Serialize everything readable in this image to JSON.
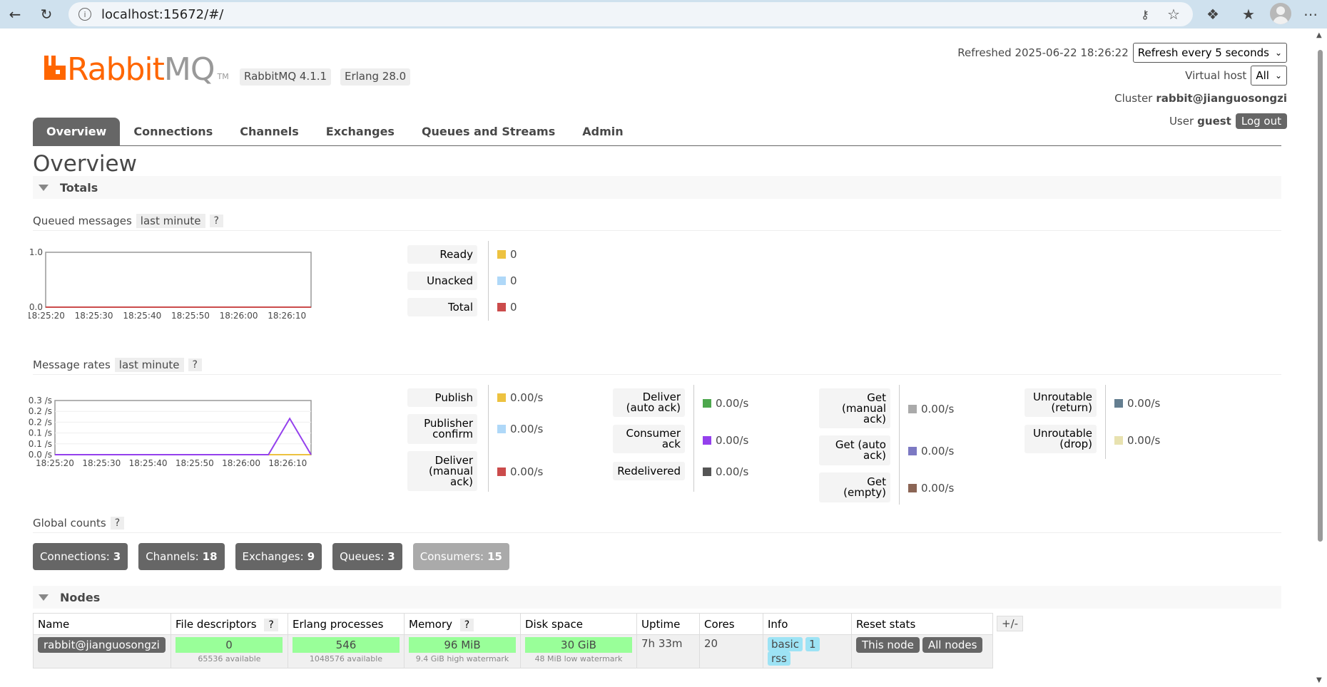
{
  "browser": {
    "url": "localhost:15672/#/"
  },
  "app": {
    "logo_rabbit": "Rabbit",
    "logo_mq": "MQ",
    "logo_tm": "TM",
    "rabbitmq_version": "RabbitMQ 4.1.1",
    "erlang_version": "Erlang 28.0",
    "refreshed_label": "Refreshed",
    "refreshed_time": "2025-06-22 18:26:22",
    "refresh_select": "Refresh every 5 seconds",
    "vhost_label": "Virtual host",
    "vhost_value": "All",
    "cluster_label": "Cluster",
    "cluster_value": "rabbit@jianguosongzi",
    "user_label": "User",
    "user_value": "guest",
    "logout_label": "Log out"
  },
  "tabs": [
    "Overview",
    "Connections",
    "Channels",
    "Exchanges",
    "Queues and Streams",
    "Admin"
  ],
  "page_title": "Overview",
  "totals": {
    "section_label": "Totals",
    "queued_label": "Queued messages",
    "queued_range": "last minute",
    "help": "?",
    "rates_label": "Message rates",
    "rates_range": "last minute",
    "queued_legend": [
      {
        "label": "Ready",
        "value": "0",
        "color": "#edc240"
      },
      {
        "label": "Unacked",
        "value": "0",
        "color": "#afd8f8"
      },
      {
        "label": "Total",
        "value": "0",
        "color": "#cb4b4b"
      }
    ],
    "rates_legend_col1": [
      {
        "label": "Publish",
        "value": "0.00/s",
        "color": "#edc240"
      },
      {
        "label": "Publisher confirm",
        "value": "0.00/s",
        "color": "#afd8f8"
      },
      {
        "label": "Deliver (manual ack)",
        "value": "0.00/s",
        "color": "#cb4b4b"
      }
    ],
    "rates_legend_col2": [
      {
        "label": "Deliver (auto ack)",
        "value": "0.00/s",
        "color": "#4da74d"
      },
      {
        "label": "Consumer ack",
        "value": "0.00/s",
        "color": "#9440ed"
      },
      {
        "label": "Redelivered",
        "value": "0.00/s",
        "color": "#555555"
      }
    ],
    "rates_legend_col3": [
      {
        "label": "Get (manual ack)",
        "value": "0.00/s",
        "color": "#aaaaaa"
      },
      {
        "label": "Get (auto ack)",
        "value": "0.00/s",
        "color": "#7c79c3"
      },
      {
        "label": "Get (empty)",
        "value": "0.00/s",
        "color": "#8b6555"
      }
    ],
    "rates_legend_col4": [
      {
        "label": "Unroutable (return)",
        "value": "0.00/s",
        "color": "#647e90"
      },
      {
        "label": "Unroutable (drop)",
        "value": "0.00/s",
        "color": "#e8e2b0"
      }
    ]
  },
  "chart_data": [
    {
      "type": "line",
      "title": "Queued messages",
      "x": [
        "18:25:20",
        "18:25:30",
        "18:25:40",
        "18:25:50",
        "18:26:00",
        "18:26:10"
      ],
      "ylim": [
        0,
        1
      ],
      "yticks": [
        "1.0",
        "0.0"
      ],
      "series": [
        {
          "name": "Total",
          "color": "#cb4b4b",
          "values": [
            0,
            0,
            0,
            0,
            0,
            0,
            0,
            0,
            0,
            0,
            0,
            0,
            0
          ]
        }
      ]
    },
    {
      "type": "line",
      "title": "Message rates",
      "x": [
        "18:25:20",
        "18:25:30",
        "18:25:40",
        "18:25:50",
        "18:26:00",
        "18:26:10"
      ],
      "ylim": [
        0,
        0.3
      ],
      "yticks": [
        "0.3 /s",
        "0.2 /s",
        "0.2 /s",
        "0.1 /s",
        "0.1 /s",
        "0.0 /s"
      ],
      "series": [
        {
          "name": "Publish",
          "color": "#edc240",
          "values": [
            0,
            0,
            0,
            0,
            0,
            0,
            0,
            0,
            0,
            0,
            0,
            0,
            0
          ]
        },
        {
          "name": "Consumer ack",
          "color": "#9440ed",
          "values": [
            0,
            0,
            0,
            0,
            0,
            0,
            0,
            0,
            0,
            0,
            0,
            0.2,
            0
          ]
        }
      ]
    }
  ],
  "global_counts": {
    "label": "Global counts",
    "help": "?",
    "items": [
      {
        "label": "Connections:",
        "value": "3"
      },
      {
        "label": "Channels:",
        "value": "18"
      },
      {
        "label": "Exchanges:",
        "value": "9"
      },
      {
        "label": "Queues:",
        "value": "3"
      },
      {
        "label": "Consumers:",
        "value": "15"
      }
    ]
  },
  "nodes": {
    "section_label": "Nodes",
    "headers": [
      "Name",
      "File descriptors",
      "Erlang processes",
      "Memory",
      "Disk space",
      "Uptime",
      "Cores",
      "Info",
      "Reset stats"
    ],
    "help": "?",
    "plus_minus": "+/-",
    "row": {
      "name": "rabbit@jianguosongzi",
      "fd": "0",
      "fd_sub": "65536 available",
      "procs": "546",
      "procs_sub": "1048576 available",
      "mem": "96 MiB",
      "mem_sub": "9.4 GiB high watermark",
      "disk": "30 GiB",
      "disk_sub": "48 MiB low watermark",
      "uptime": "7h 33m",
      "cores": "20",
      "info": [
        "basic",
        "1",
        "rss"
      ],
      "reset_this": "This node",
      "reset_all": "All nodes"
    }
  }
}
